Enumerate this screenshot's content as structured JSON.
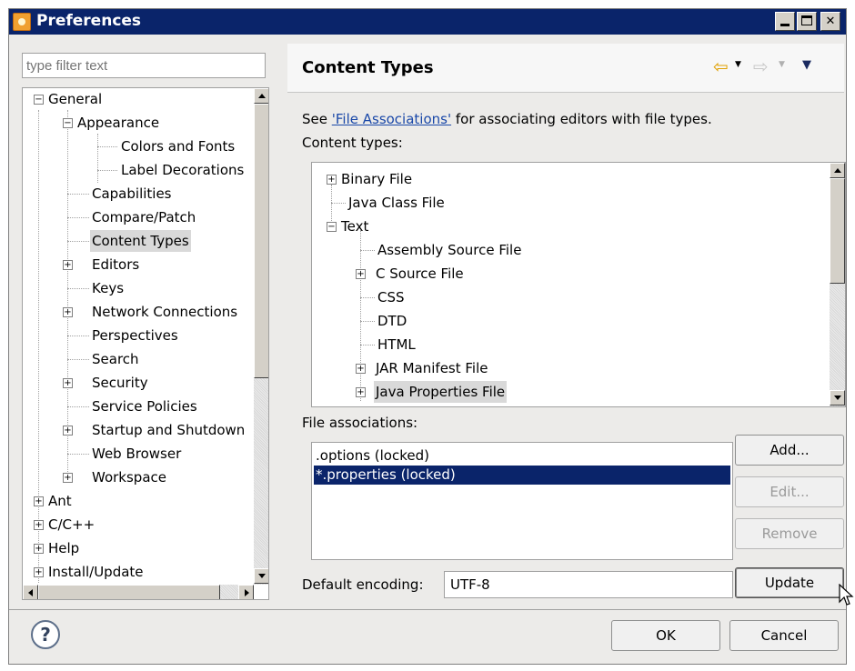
{
  "window": {
    "title": "Preferences"
  },
  "left": {
    "filter_placeholder": "type filter text",
    "tree": {
      "general": "General",
      "appearance": "Appearance",
      "colors_fonts": "Colors and Fonts",
      "label_decorations": "Label Decorations",
      "capabilities": "Capabilities",
      "compare_patch": "Compare/Patch",
      "content_types": "Content Types",
      "editors": "Editors",
      "keys": "Keys",
      "network_connections": "Network Connections",
      "perspectives": "Perspectives",
      "search": "Search",
      "security": "Security",
      "service_policies": "Service Policies",
      "startup_shutdown": "Startup and Shutdown",
      "web_browser": "Web Browser",
      "workspace": "Workspace",
      "ant": "Ant",
      "cpp": "C/C++",
      "help": "Help",
      "install_update": "Install/Update"
    }
  },
  "right": {
    "title": "Content Types",
    "desc_prefix": "See ",
    "desc_link": "'File Associations'",
    "desc_suffix": " for associating editors with file types.",
    "content_types_label": "Content types:",
    "content_types": {
      "binary": "Binary File",
      "java_class": "Java Class File",
      "text": "Text",
      "assembly": "Assembly Source File",
      "c_source": "C Source File",
      "css": "CSS",
      "dtd": "DTD",
      "html": "HTML",
      "jar_manifest": "JAR Manifest File",
      "java_properties": "Java Properties File"
    },
    "file_assoc_label": "File associations:",
    "file_assoc": [
      ".options (locked)",
      "*.properties (locked)"
    ],
    "buttons": {
      "add": "Add...",
      "edit": "Edit...",
      "remove": "Remove",
      "update": "Update"
    },
    "encoding_label": "Default encoding:",
    "encoding_value": "UTF-8"
  },
  "footer": {
    "ok": "OK",
    "cancel": "Cancel",
    "help_glyph": "?"
  },
  "icons": {
    "back": "back-arrow-icon",
    "forward": "forward-arrow-icon",
    "menu": "view-menu-icon",
    "help": "help-icon",
    "app": "eclipse-icon"
  },
  "colors": {
    "title_bar": "#0a246a",
    "selection": "#0a246a",
    "link": "#1a48a8",
    "back_arrow": "#e0a000"
  }
}
